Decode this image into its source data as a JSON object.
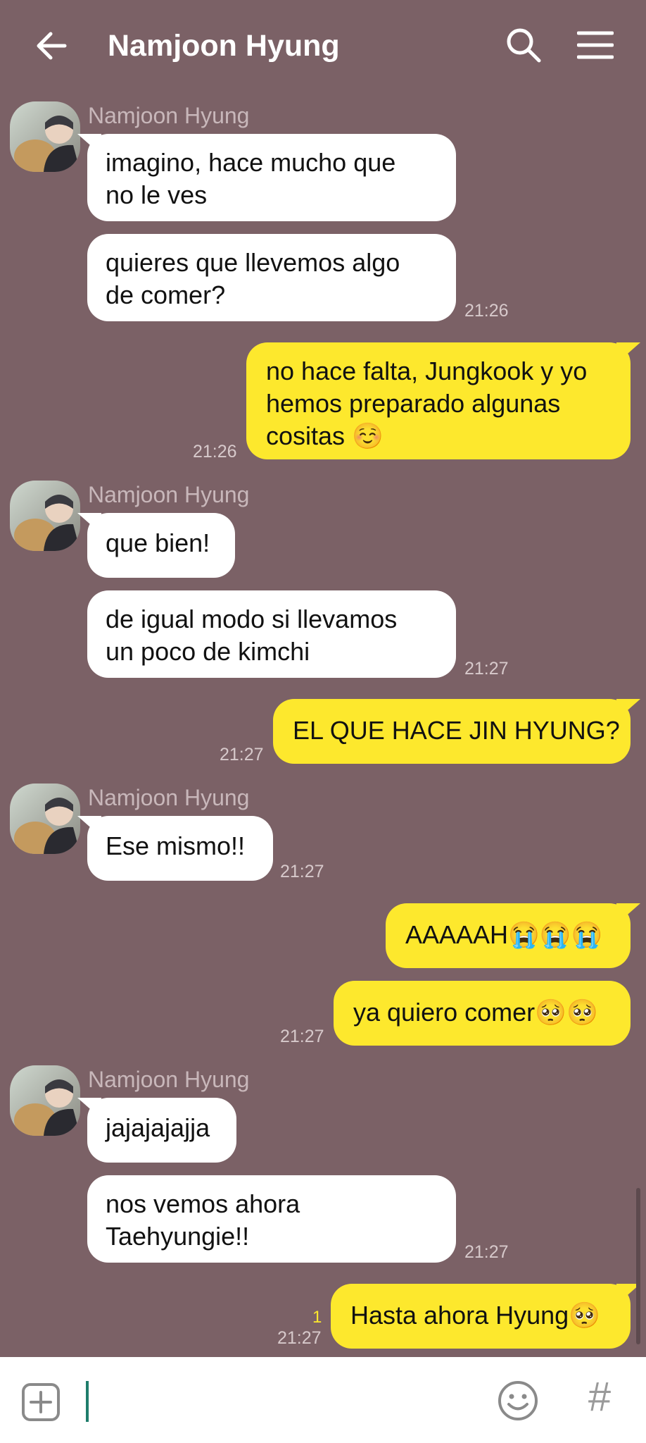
{
  "header": {
    "title": "Namjoon Hyung",
    "back_icon": "arrow-left-icon",
    "search_icon": "search-icon",
    "menu_icon": "hamburger-menu-icon"
  },
  "colors": {
    "background": "#7b6166",
    "incoming_bubble": "#ffffff",
    "outgoing_bubble": "#fde82d",
    "unread_count": "#fde82d"
  },
  "messages": [
    {
      "group": 1,
      "sender": "Namjoon Hyung",
      "direction": "in",
      "lines": [
        "imagino, hace mucho que",
        "no le ves"
      ]
    },
    {
      "group": 1,
      "direction": "in",
      "lines": [
        "quieres que llevemos algo",
        "de comer?"
      ],
      "time": "21:26"
    },
    {
      "direction": "out",
      "lines": [
        "no hace falta, Jungkook y yo",
        "hemos preparado algunas",
        "cositas ☺️"
      ],
      "time": "21:26"
    },
    {
      "group": 2,
      "sender": "Namjoon Hyung",
      "direction": "in",
      "lines": [
        "que bien!"
      ]
    },
    {
      "group": 2,
      "direction": "in",
      "lines": [
        "de igual modo si llevamos",
        "un poco de kimchi"
      ],
      "time": "21:27"
    },
    {
      "direction": "out",
      "lines": [
        "EL QUE HACE JIN HYUNG?"
      ],
      "time": "21:27"
    },
    {
      "group": 3,
      "sender": "Namjoon Hyung",
      "direction": "in",
      "lines": [
        "Ese mismo!!"
      ],
      "time": "21:27"
    },
    {
      "direction": "out",
      "lines": [
        "AAAAAH😭😭😭"
      ]
    },
    {
      "direction": "out",
      "lines": [
        "ya quiero comer🥺🥺"
      ],
      "time": "21:27"
    },
    {
      "group": 4,
      "sender": "Namjoon Hyung",
      "direction": "in",
      "lines": [
        "jajajajajja"
      ]
    },
    {
      "group": 4,
      "direction": "in",
      "lines": [
        "nos vemos ahora",
        "Taehyungie!!"
      ],
      "time": "21:27"
    },
    {
      "direction": "out",
      "lines": [
        "Hasta ahora Hyung🥺"
      ],
      "time": "21:27",
      "unread": "1"
    }
  ],
  "input": {
    "add_icon": "plus-square-icon",
    "emoji_icon": "smiley-icon",
    "hash_label": "#"
  }
}
